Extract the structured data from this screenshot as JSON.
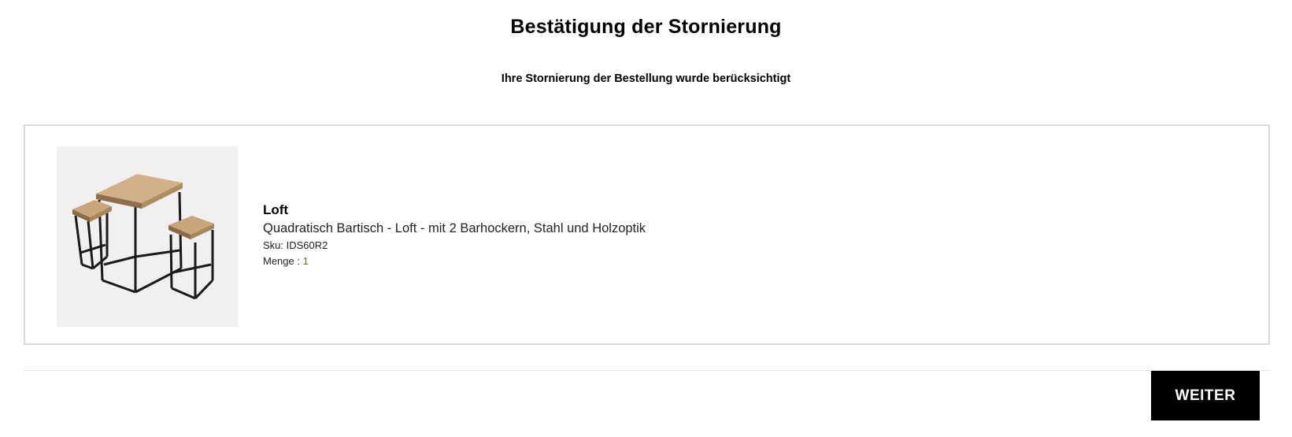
{
  "header": {
    "title": "Bestätigung der Stornierung",
    "subtitle": "Ihre Stornierung der Bestellung wurde berücksichtigt"
  },
  "order_item": {
    "image_icon": "bar-table-with-stools-image",
    "name": "Loft",
    "description": "Quadratisch Bartisch - Loft - mit 2 Barhockern, Stahl und Holzoptik",
    "sku_label": "Sku: ",
    "sku": "IDS60R2",
    "quantity_label": "Menge : ",
    "quantity": "1"
  },
  "actions": {
    "next_label": "WEITER"
  },
  "colors": {
    "button_bg": "#000000",
    "button_text": "#ffffff",
    "card_border": "#d9d9d9",
    "image_bg": "#f0f0f0"
  }
}
